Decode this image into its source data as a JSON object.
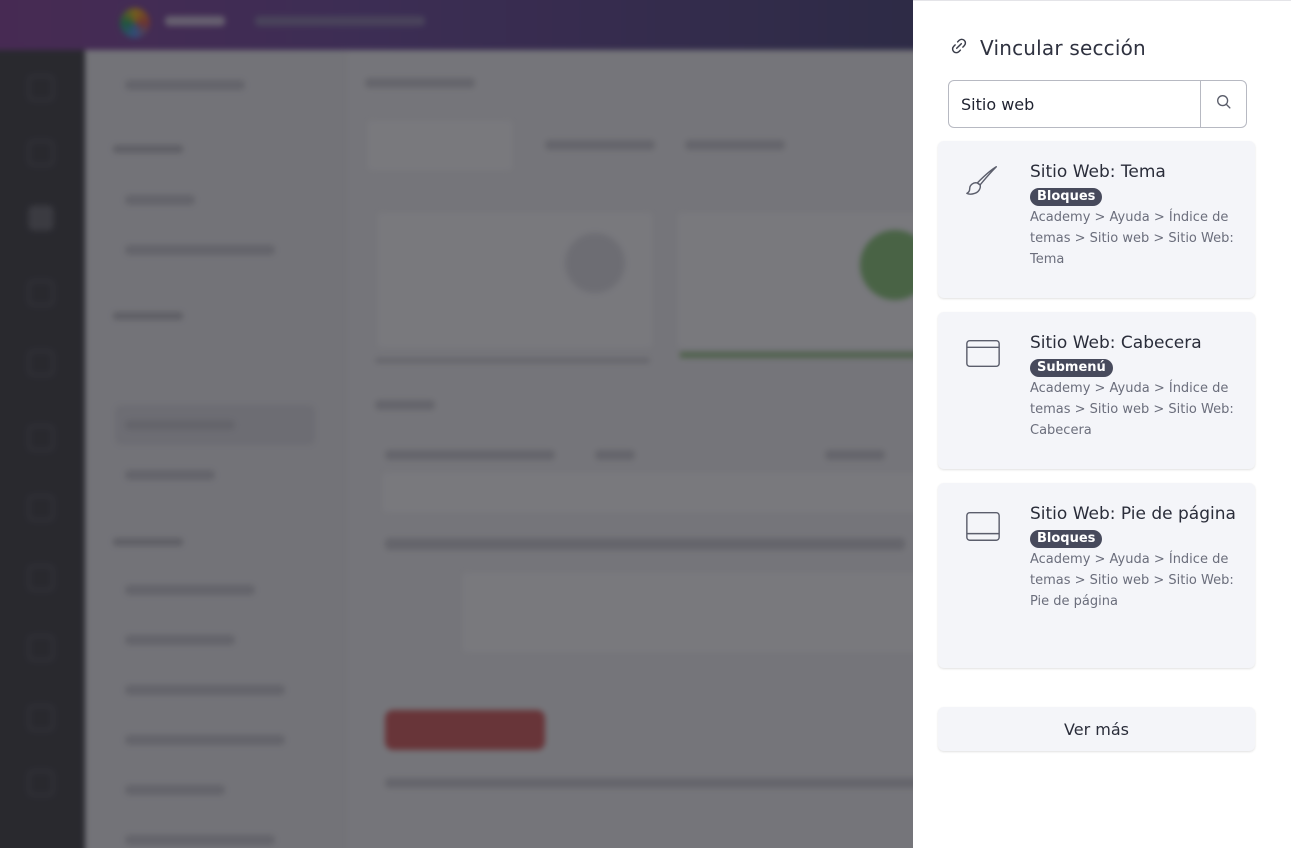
{
  "panel": {
    "title": "Vincular sección",
    "title_icon": "link-icon"
  },
  "search": {
    "value": "Sitio web",
    "button_icon": "search-icon"
  },
  "results": [
    {
      "icon": "paintbrush-icon",
      "title": "Sitio Web: Tema",
      "badge": "Bloques",
      "breadcrumb": "Academy > Ayuda > Índice de temas > Sitio web > Sitio Web: Tema"
    },
    {
      "icon": "browser-window-icon",
      "title": "Sitio Web: Cabecera",
      "badge": "Submenú",
      "breadcrumb": "Academy > Ayuda > Índice de temas > Sitio web > Sitio Web: Cabecera"
    },
    {
      "icon": "footer-layout-icon",
      "title": "Sitio Web: Pie de página",
      "badge": "Bloques",
      "breadcrumb": "Academy > Ayuda > Índice de temas > Sitio web > Sitio Web: Pie de página"
    }
  ],
  "more_button": "Ver más"
}
